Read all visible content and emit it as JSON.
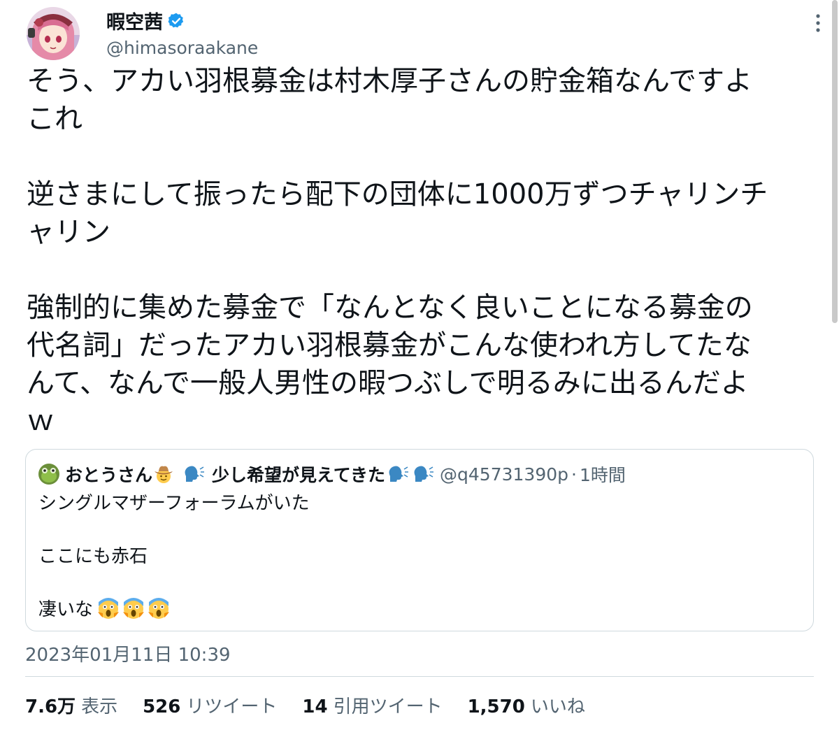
{
  "author": {
    "name": "暇空茜",
    "handle": "@himasoraakane",
    "verified": true,
    "avatar_icon": "anime-girl-avatar"
  },
  "tweet": {
    "text": "そう、アカい羽根募金は村木厚子さんの貯金箱なんですよ\nこれ\n\n逆さまにして振ったら配下の団体に1000万ずつチャリンチ\nャリン\n\n強制的に集めた募金で「なんとなく良いことになる募金の\n代名詞」だったアカい羽根募金がこんな使われ方してたな\nんて、なんで一般人男性の暇つぶしで明るみに出るんだよ\nｗ"
  },
  "quote": {
    "name": "おとうさん",
    "name_suffix": "少し希望が見えてきた",
    "handle": "@q45731390p",
    "separator": "·",
    "time": "1時間",
    "text": "シングルマザーフォーラムがいた\n\nここにも赤石\n\n凄いな",
    "emoji_icons": [
      "cowboy-face-emoji",
      "speaking-head-emoji",
      "speaking-head-emoji",
      "screaming-face-emoji"
    ]
  },
  "timestamp": "2023年01月11日 10:39",
  "stats": {
    "views": {
      "count": "7.6万",
      "label": "表示"
    },
    "retweets": {
      "count": "526",
      "label": "リツイート"
    },
    "quotes": {
      "count": "14",
      "label": "引用ツイート"
    },
    "likes": {
      "count": "1,570",
      "label": "いいね"
    }
  },
  "colors": {
    "text": "#0f1419",
    "secondary": "#536471",
    "border": "#cfd9de",
    "verified": "#1d9bf0"
  }
}
